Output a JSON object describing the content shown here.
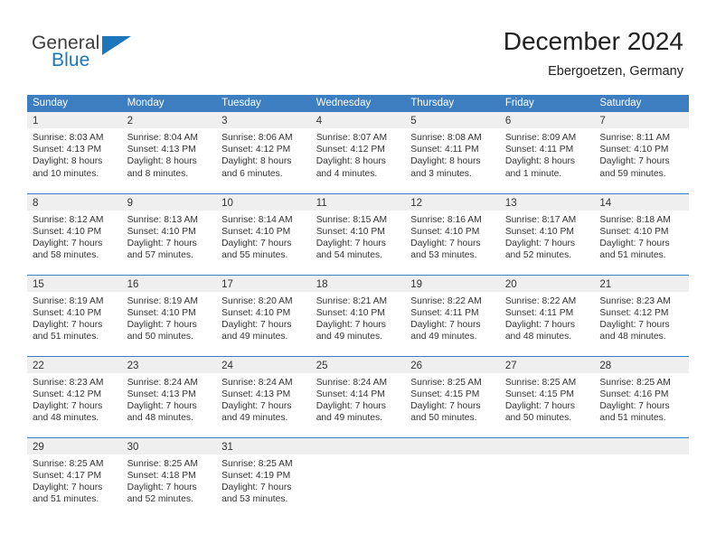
{
  "brand": {
    "name_part1": "General",
    "name_part2": "Blue",
    "accent_color": "#1b76bc"
  },
  "header": {
    "title": "December 2024",
    "subtitle": "Ebergoetzen, Germany"
  },
  "theme": {
    "header_blue": "#3c7ebf",
    "date_band_gray": "#efefef",
    "text_color": "#333333"
  },
  "weekday_headers": [
    "Sunday",
    "Monday",
    "Tuesday",
    "Wednesday",
    "Thursday",
    "Friday",
    "Saturday"
  ],
  "weeks": [
    {
      "days": [
        {
          "date": "1",
          "sunrise": "Sunrise: 8:03 AM",
          "sunset": "Sunset: 4:13 PM",
          "daylight_line1": "Daylight: 8 hours",
          "daylight_line2": "and 10 minutes."
        },
        {
          "date": "2",
          "sunrise": "Sunrise: 8:04 AM",
          "sunset": "Sunset: 4:13 PM",
          "daylight_line1": "Daylight: 8 hours",
          "daylight_line2": "and 8 minutes."
        },
        {
          "date": "3",
          "sunrise": "Sunrise: 8:06 AM",
          "sunset": "Sunset: 4:12 PM",
          "daylight_line1": "Daylight: 8 hours",
          "daylight_line2": "and 6 minutes."
        },
        {
          "date": "4",
          "sunrise": "Sunrise: 8:07 AM",
          "sunset": "Sunset: 4:12 PM",
          "daylight_line1": "Daylight: 8 hours",
          "daylight_line2": "and 4 minutes."
        },
        {
          "date": "5",
          "sunrise": "Sunrise: 8:08 AM",
          "sunset": "Sunset: 4:11 PM",
          "daylight_line1": "Daylight: 8 hours",
          "daylight_line2": "and 3 minutes."
        },
        {
          "date": "6",
          "sunrise": "Sunrise: 8:09 AM",
          "sunset": "Sunset: 4:11 PM",
          "daylight_line1": "Daylight: 8 hours",
          "daylight_line2": "and 1 minute."
        },
        {
          "date": "7",
          "sunrise": "Sunrise: 8:11 AM",
          "sunset": "Sunset: 4:10 PM",
          "daylight_line1": "Daylight: 7 hours",
          "daylight_line2": "and 59 minutes."
        }
      ]
    },
    {
      "days": [
        {
          "date": "8",
          "sunrise": "Sunrise: 8:12 AM",
          "sunset": "Sunset: 4:10 PM",
          "daylight_line1": "Daylight: 7 hours",
          "daylight_line2": "and 58 minutes."
        },
        {
          "date": "9",
          "sunrise": "Sunrise: 8:13 AM",
          "sunset": "Sunset: 4:10 PM",
          "daylight_line1": "Daylight: 7 hours",
          "daylight_line2": "and 57 minutes."
        },
        {
          "date": "10",
          "sunrise": "Sunrise: 8:14 AM",
          "sunset": "Sunset: 4:10 PM",
          "daylight_line1": "Daylight: 7 hours",
          "daylight_line2": "and 55 minutes."
        },
        {
          "date": "11",
          "sunrise": "Sunrise: 8:15 AM",
          "sunset": "Sunset: 4:10 PM",
          "daylight_line1": "Daylight: 7 hours",
          "daylight_line2": "and 54 minutes."
        },
        {
          "date": "12",
          "sunrise": "Sunrise: 8:16 AM",
          "sunset": "Sunset: 4:10 PM",
          "daylight_line1": "Daylight: 7 hours",
          "daylight_line2": "and 53 minutes."
        },
        {
          "date": "13",
          "sunrise": "Sunrise: 8:17 AM",
          "sunset": "Sunset: 4:10 PM",
          "daylight_line1": "Daylight: 7 hours",
          "daylight_line2": "and 52 minutes."
        },
        {
          "date": "14",
          "sunrise": "Sunrise: 8:18 AM",
          "sunset": "Sunset: 4:10 PM",
          "daylight_line1": "Daylight: 7 hours",
          "daylight_line2": "and 51 minutes."
        }
      ]
    },
    {
      "days": [
        {
          "date": "15",
          "sunrise": "Sunrise: 8:19 AM",
          "sunset": "Sunset: 4:10 PM",
          "daylight_line1": "Daylight: 7 hours",
          "daylight_line2": "and 51 minutes."
        },
        {
          "date": "16",
          "sunrise": "Sunrise: 8:19 AM",
          "sunset": "Sunset: 4:10 PM",
          "daylight_line1": "Daylight: 7 hours",
          "daylight_line2": "and 50 minutes."
        },
        {
          "date": "17",
          "sunrise": "Sunrise: 8:20 AM",
          "sunset": "Sunset: 4:10 PM",
          "daylight_line1": "Daylight: 7 hours",
          "daylight_line2": "and 49 minutes."
        },
        {
          "date": "18",
          "sunrise": "Sunrise: 8:21 AM",
          "sunset": "Sunset: 4:10 PM",
          "daylight_line1": "Daylight: 7 hours",
          "daylight_line2": "and 49 minutes."
        },
        {
          "date": "19",
          "sunrise": "Sunrise: 8:22 AM",
          "sunset": "Sunset: 4:11 PM",
          "daylight_line1": "Daylight: 7 hours",
          "daylight_line2": "and 49 minutes."
        },
        {
          "date": "20",
          "sunrise": "Sunrise: 8:22 AM",
          "sunset": "Sunset: 4:11 PM",
          "daylight_line1": "Daylight: 7 hours",
          "daylight_line2": "and 48 minutes."
        },
        {
          "date": "21",
          "sunrise": "Sunrise: 8:23 AM",
          "sunset": "Sunset: 4:12 PM",
          "daylight_line1": "Daylight: 7 hours",
          "daylight_line2": "and 48 minutes."
        }
      ]
    },
    {
      "days": [
        {
          "date": "22",
          "sunrise": "Sunrise: 8:23 AM",
          "sunset": "Sunset: 4:12 PM",
          "daylight_line1": "Daylight: 7 hours",
          "daylight_line2": "and 48 minutes."
        },
        {
          "date": "23",
          "sunrise": "Sunrise: 8:24 AM",
          "sunset": "Sunset: 4:13 PM",
          "daylight_line1": "Daylight: 7 hours",
          "daylight_line2": "and 48 minutes."
        },
        {
          "date": "24",
          "sunrise": "Sunrise: 8:24 AM",
          "sunset": "Sunset: 4:13 PM",
          "daylight_line1": "Daylight: 7 hours",
          "daylight_line2": "and 49 minutes."
        },
        {
          "date": "25",
          "sunrise": "Sunrise: 8:24 AM",
          "sunset": "Sunset: 4:14 PM",
          "daylight_line1": "Daylight: 7 hours",
          "daylight_line2": "and 49 minutes."
        },
        {
          "date": "26",
          "sunrise": "Sunrise: 8:25 AM",
          "sunset": "Sunset: 4:15 PM",
          "daylight_line1": "Daylight: 7 hours",
          "daylight_line2": "and 50 minutes."
        },
        {
          "date": "27",
          "sunrise": "Sunrise: 8:25 AM",
          "sunset": "Sunset: 4:15 PM",
          "daylight_line1": "Daylight: 7 hours",
          "daylight_line2": "and 50 minutes."
        },
        {
          "date": "28",
          "sunrise": "Sunrise: 8:25 AM",
          "sunset": "Sunset: 4:16 PM",
          "daylight_line1": "Daylight: 7 hours",
          "daylight_line2": "and 51 minutes."
        }
      ]
    },
    {
      "days": [
        {
          "date": "29",
          "sunrise": "Sunrise: 8:25 AM",
          "sunset": "Sunset: 4:17 PM",
          "daylight_line1": "Daylight: 7 hours",
          "daylight_line2": "and 51 minutes."
        },
        {
          "date": "30",
          "sunrise": "Sunrise: 8:25 AM",
          "sunset": "Sunset: 4:18 PM",
          "daylight_line1": "Daylight: 7 hours",
          "daylight_line2": "and 52 minutes."
        },
        {
          "date": "31",
          "sunrise": "Sunrise: 8:25 AM",
          "sunset": "Sunset: 4:19 PM",
          "daylight_line1": "Daylight: 7 hours",
          "daylight_line2": "and 53 minutes."
        },
        {
          "date": "",
          "sunrise": "",
          "sunset": "",
          "daylight_line1": "",
          "daylight_line2": ""
        },
        {
          "date": "",
          "sunrise": "",
          "sunset": "",
          "daylight_line1": "",
          "daylight_line2": ""
        },
        {
          "date": "",
          "sunrise": "",
          "sunset": "",
          "daylight_line1": "",
          "daylight_line2": ""
        },
        {
          "date": "",
          "sunrise": "",
          "sunset": "",
          "daylight_line1": "",
          "daylight_line2": ""
        }
      ]
    }
  ]
}
